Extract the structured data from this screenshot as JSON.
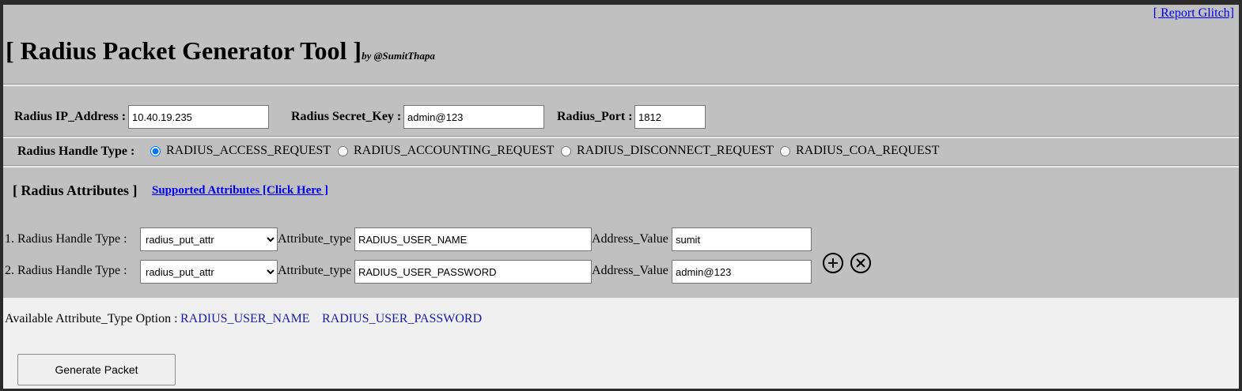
{
  "header": {
    "report_link": "[ Report Glitch]",
    "title": "[ Radius Packet Generator Tool ]",
    "byline": "by @SumitThapa"
  },
  "connection": {
    "ip_label": "Radius IP_Address :",
    "ip_value": "10.40.19.235",
    "secret_label": "Radius Secret_Key :",
    "secret_value": "admin@123",
    "port_label": "Radius_Port :",
    "port_value": "1812"
  },
  "handle_type": {
    "label": "Radius Handle Type :",
    "options": [
      {
        "label": "RADIUS_ACCESS_REQUEST",
        "checked": true
      },
      {
        "label": "RADIUS_ACCOUNTING_REQUEST",
        "checked": false
      },
      {
        "label": "RADIUS_DISCONNECT_REQUEST",
        "checked": false
      },
      {
        "label": "RADIUS_COA_REQUEST",
        "checked": false
      }
    ]
  },
  "attributes": {
    "section_title": "[ Radius Attributes ]",
    "supported_link": "Supported Attributes [Click Here ]",
    "rows": [
      {
        "label": "1. Radius Handle Type :",
        "select_value": "radius_put_attr",
        "attr_type_label": "Attribute_type",
        "attr_type_value": "RADIUS_USER_NAME",
        "addr_label": "Address_Value",
        "addr_value": "sumit"
      },
      {
        "label": "2. Radius Handle Type :",
        "select_value": "radius_put_attr",
        "attr_type_label": "Attribute_type",
        "attr_type_value": "RADIUS_USER_PASSWORD",
        "addr_label": "Address_Value",
        "addr_value": "admin@123"
      }
    ],
    "add_icon": "plus-circle-icon",
    "remove_icon": "x-circle-icon"
  },
  "available": {
    "label": "Available Attribute_Type Option :",
    "options": [
      "RADIUS_USER_NAME",
      "RADIUS_USER_PASSWORD"
    ]
  },
  "generate_button": "Generate Packet",
  "colors": {
    "panel_gray": "#c0c0c0",
    "page_bg": "#f0f0f0",
    "link": "#0000ee",
    "option_link": "#1a1aa6"
  }
}
